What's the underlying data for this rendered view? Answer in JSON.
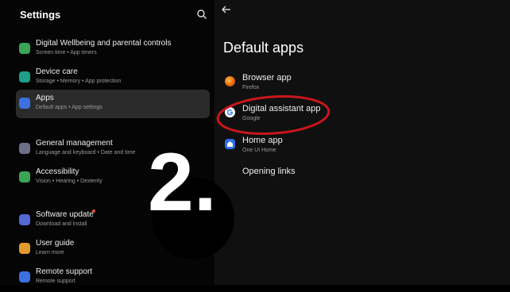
{
  "left_panel": {
    "title": "Settings",
    "items": [
      {
        "label": "Digital Wellbeing and parental controls",
        "sub": "Screen time  •  App timers",
        "icon": "wellbeing-icon",
        "color": "#3aa655"
      },
      {
        "label": "Device care",
        "sub": "Storage  •  Memory  •  App protection",
        "icon": "device-care-icon",
        "color": "#1f9e8a"
      },
      {
        "label": "Apps",
        "sub": "Default apps  •  App settings",
        "icon": "apps-icon",
        "color": "#3d6fe0"
      },
      {
        "label": "General management",
        "sub": "Language and keyboard  •  Date and time",
        "icon": "sliders-icon",
        "color": "#6c6f86"
      },
      {
        "label": "Accessibility",
        "sub": "Vision  •  Hearing  •  Dexterity",
        "icon": "accessibility-icon",
        "color": "#3aa655"
      },
      {
        "label": "Software update",
        "sub": "Download and install",
        "icon": "software-update-icon",
        "color": "#5468d4"
      },
      {
        "label": "User guide",
        "sub": "Learn more",
        "icon": "user-guide-icon",
        "color": "#e29b2a"
      },
      {
        "label": "Remote support",
        "sub": "Remote support",
        "icon": "remote-support-icon",
        "color": "#3d6fe0"
      }
    ]
  },
  "right_panel": {
    "title": "Default apps",
    "apps": [
      {
        "label": "Browser app",
        "sub": "Firefox",
        "icon": "firefox-icon"
      },
      {
        "label": "Digital assistant app",
        "sub": "Google",
        "icon": "google-icon"
      },
      {
        "label": "Home app",
        "sub": "One UI Home",
        "icon": "home-icon"
      },
      {
        "label": "Opening links",
        "sub": "",
        "icon": ""
      }
    ]
  },
  "overlay": {
    "step_number": "2.",
    "highlight_color": "#c8161d"
  }
}
